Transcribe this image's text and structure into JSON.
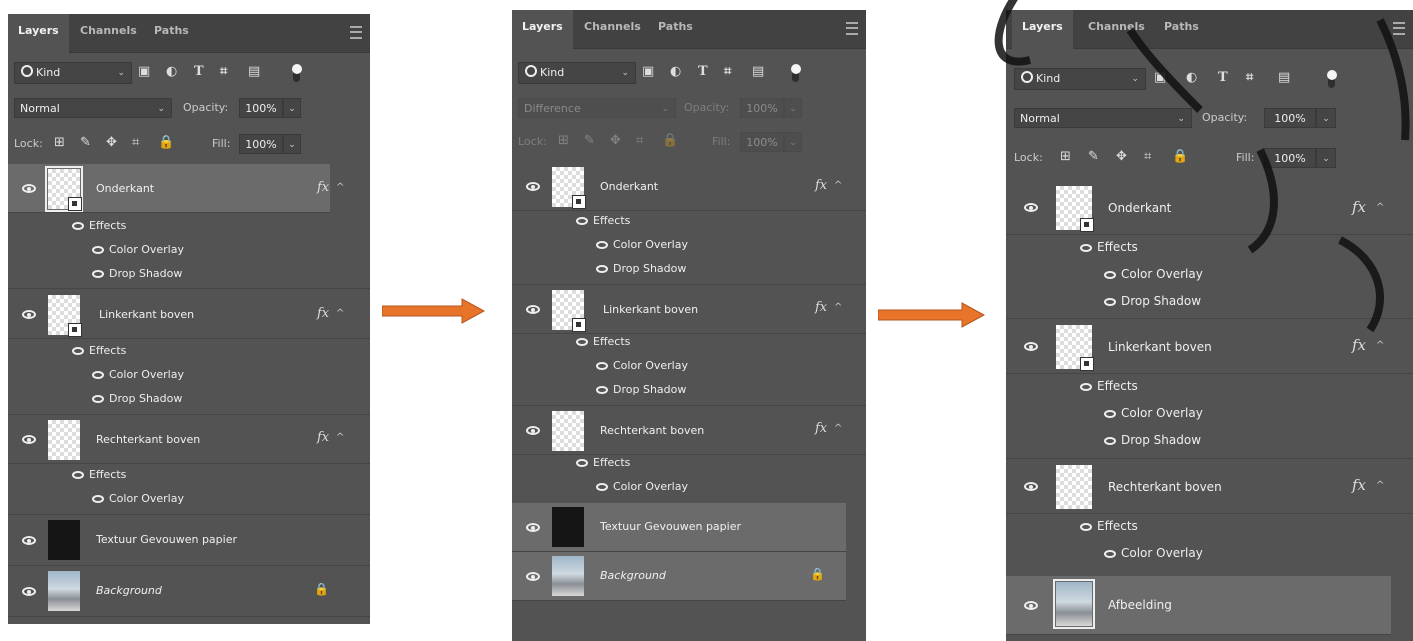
{
  "tabs": {
    "layers": "Layers",
    "channels": "Channels",
    "paths": "Paths"
  },
  "filter": {
    "kind": "Kind"
  },
  "opacity_label": "Opacity:",
  "opacity_value": "100%",
  "lock_label": "Lock:",
  "fill_label": "Fill:",
  "fill_value": "100%",
  "panel1": {
    "blend": "Normal",
    "layers": [
      {
        "name": "Onderkant",
        "effects_label": "Effects",
        "effects": [
          "Color Overlay",
          "Drop Shadow"
        ]
      },
      {
        "name": "Linkerkant boven",
        "effects_label": "Effects",
        "effects": [
          "Color Overlay",
          "Drop Shadow"
        ]
      },
      {
        "name": "Rechterkant boven",
        "effects_label": "Effects",
        "effects": [
          "Color Overlay"
        ]
      },
      {
        "name": "Textuur Gevouwen papier"
      },
      {
        "name": "Background"
      }
    ]
  },
  "panel2": {
    "blend": "Difference",
    "layers": [
      {
        "name": "Onderkant",
        "effects_label": "Effects",
        "effects": [
          "Color Overlay",
          "Drop Shadow"
        ]
      },
      {
        "name": "Linkerkant boven",
        "effects_label": "Effects",
        "effects": [
          "Color Overlay",
          "Drop Shadow"
        ]
      },
      {
        "name": "Rechterkant boven",
        "effects_label": "Effects",
        "effects": [
          "Color Overlay"
        ]
      },
      {
        "name": "Textuur Gevouwen papier"
      },
      {
        "name": "Background"
      }
    ]
  },
  "panel3": {
    "blend": "Normal",
    "layers": [
      {
        "name": "Onderkant",
        "effects_label": "Effects",
        "effects": [
          "Color Overlay",
          "Drop Shadow"
        ]
      },
      {
        "name": "Linkerkant boven",
        "effects_label": "Effects",
        "effects": [
          "Color Overlay",
          "Drop Shadow"
        ]
      },
      {
        "name": "Rechterkant boven",
        "effects_label": "Effects",
        "effects": [
          "Color Overlay"
        ]
      },
      {
        "name": "Afbeelding"
      }
    ]
  },
  "colors": {
    "panel_bg": "#535353",
    "tab_bg": "#424242",
    "selected_row": "#6b6b6b",
    "arrow": "#e8742a"
  }
}
